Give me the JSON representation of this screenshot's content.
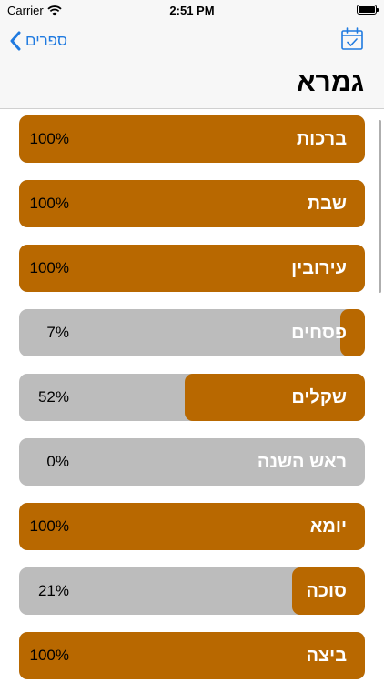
{
  "status_bar": {
    "carrier": "Carrier",
    "time": "2:51 PM"
  },
  "nav": {
    "back_label": "ספרים",
    "title": "גמרא"
  },
  "colors": {
    "fill": "#b86800",
    "track": "#bcbcbc",
    "accent": "#1f7ae0"
  },
  "tractates": [
    {
      "name": "ברכות",
      "percent": "100%",
      "progress": 100
    },
    {
      "name": "שבת",
      "percent": "100%",
      "progress": 100
    },
    {
      "name": "עירובין",
      "percent": "100%",
      "progress": 100
    },
    {
      "name": "פסחים",
      "percent": "7%",
      "progress": 7
    },
    {
      "name": "שקלים",
      "percent": "52%",
      "progress": 52
    },
    {
      "name": "ראש השנה",
      "percent": "0%",
      "progress": 0
    },
    {
      "name": "יומא",
      "percent": "100%",
      "progress": 100
    },
    {
      "name": "סוכה",
      "percent": "21%",
      "progress": 21
    },
    {
      "name": "ביצה",
      "percent": "100%",
      "progress": 100
    }
  ]
}
